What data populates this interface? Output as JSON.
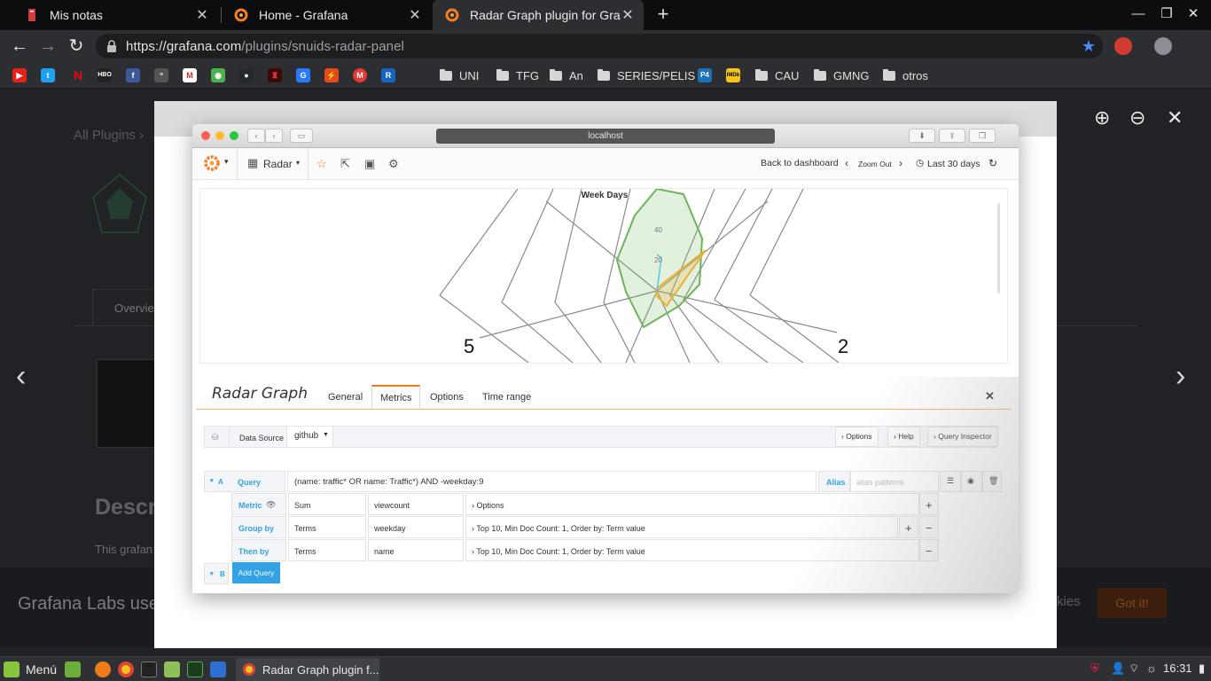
{
  "browser": {
    "tabs": [
      {
        "title": "Mis notas",
        "icon": "notes-icon"
      },
      {
        "title": "Home - Grafana",
        "icon": "grafana-icon"
      },
      {
        "title": "Radar Graph plugin for Grafana",
        "icon": "grafana-icon"
      }
    ],
    "url_host": "https://grafana.com",
    "url_path": "/plugins/snuids-radar-panel",
    "bookmark_folders": [
      "UNI",
      "TFG",
      "An",
      "SERIES/PELIS",
      "CAU",
      "GMNG",
      "otros"
    ]
  },
  "background_page": {
    "breadcrumb": "All Plugins ›",
    "tab": "Overvie",
    "heading": "Descr",
    "text": "This grafan",
    "cookie_text": "Grafana Labs use",
    "cookie_tail": "kies",
    "got_it": "Got it!"
  },
  "mac_window": {
    "address": "localhost"
  },
  "grafana": {
    "dashboard": "Radar",
    "back_to_dashboard": "Back to dashboard",
    "zoom_out": "Zoom Out",
    "time_range": "Last 30 days",
    "panel_title": "Week Days",
    "chart_labels": [
      "40",
      "20",
      "5",
      "2"
    ],
    "editor_title": "Radar Graph",
    "editor_tabs": [
      "General",
      "Metrics",
      "Options",
      "Time range"
    ],
    "active_tab": "Metrics",
    "datasource_label": "Data Source",
    "datasource_value": "github",
    "ds_buttons": [
      "Options",
      "Help",
      "Query Inspector"
    ],
    "query": {
      "letter": "A",
      "label": "Query",
      "value": "(name: traffic* OR name: Traffic*) AND -weekday:9",
      "alias_label": "Alias",
      "alias_placeholder": "alias patterns"
    },
    "rows": [
      {
        "label": "Metric",
        "col1": "Sum",
        "col2": "viewcount",
        "col3": "Options"
      },
      {
        "label": "Group by",
        "col1": "Terms",
        "col2": "weekday",
        "col3": "Top 10, Min Doc Count: 1, Order by: Term value"
      },
      {
        "label": "Then by",
        "col1": "Terms",
        "col2": "name",
        "col3": "Top 10, Min Doc Count: 1, Order by: Term value"
      }
    ],
    "query_b_letter": "B",
    "add_query": "Add Query"
  },
  "taskbar": {
    "menu": "Menú",
    "window": "Radar Graph plugin f...",
    "time": "16:31"
  },
  "colors": {
    "accent_blue": "#33a2e5",
    "active_orange": "#eb7b18",
    "series_green": "#6cb55b",
    "series_yellow": "#e9b23a"
  }
}
